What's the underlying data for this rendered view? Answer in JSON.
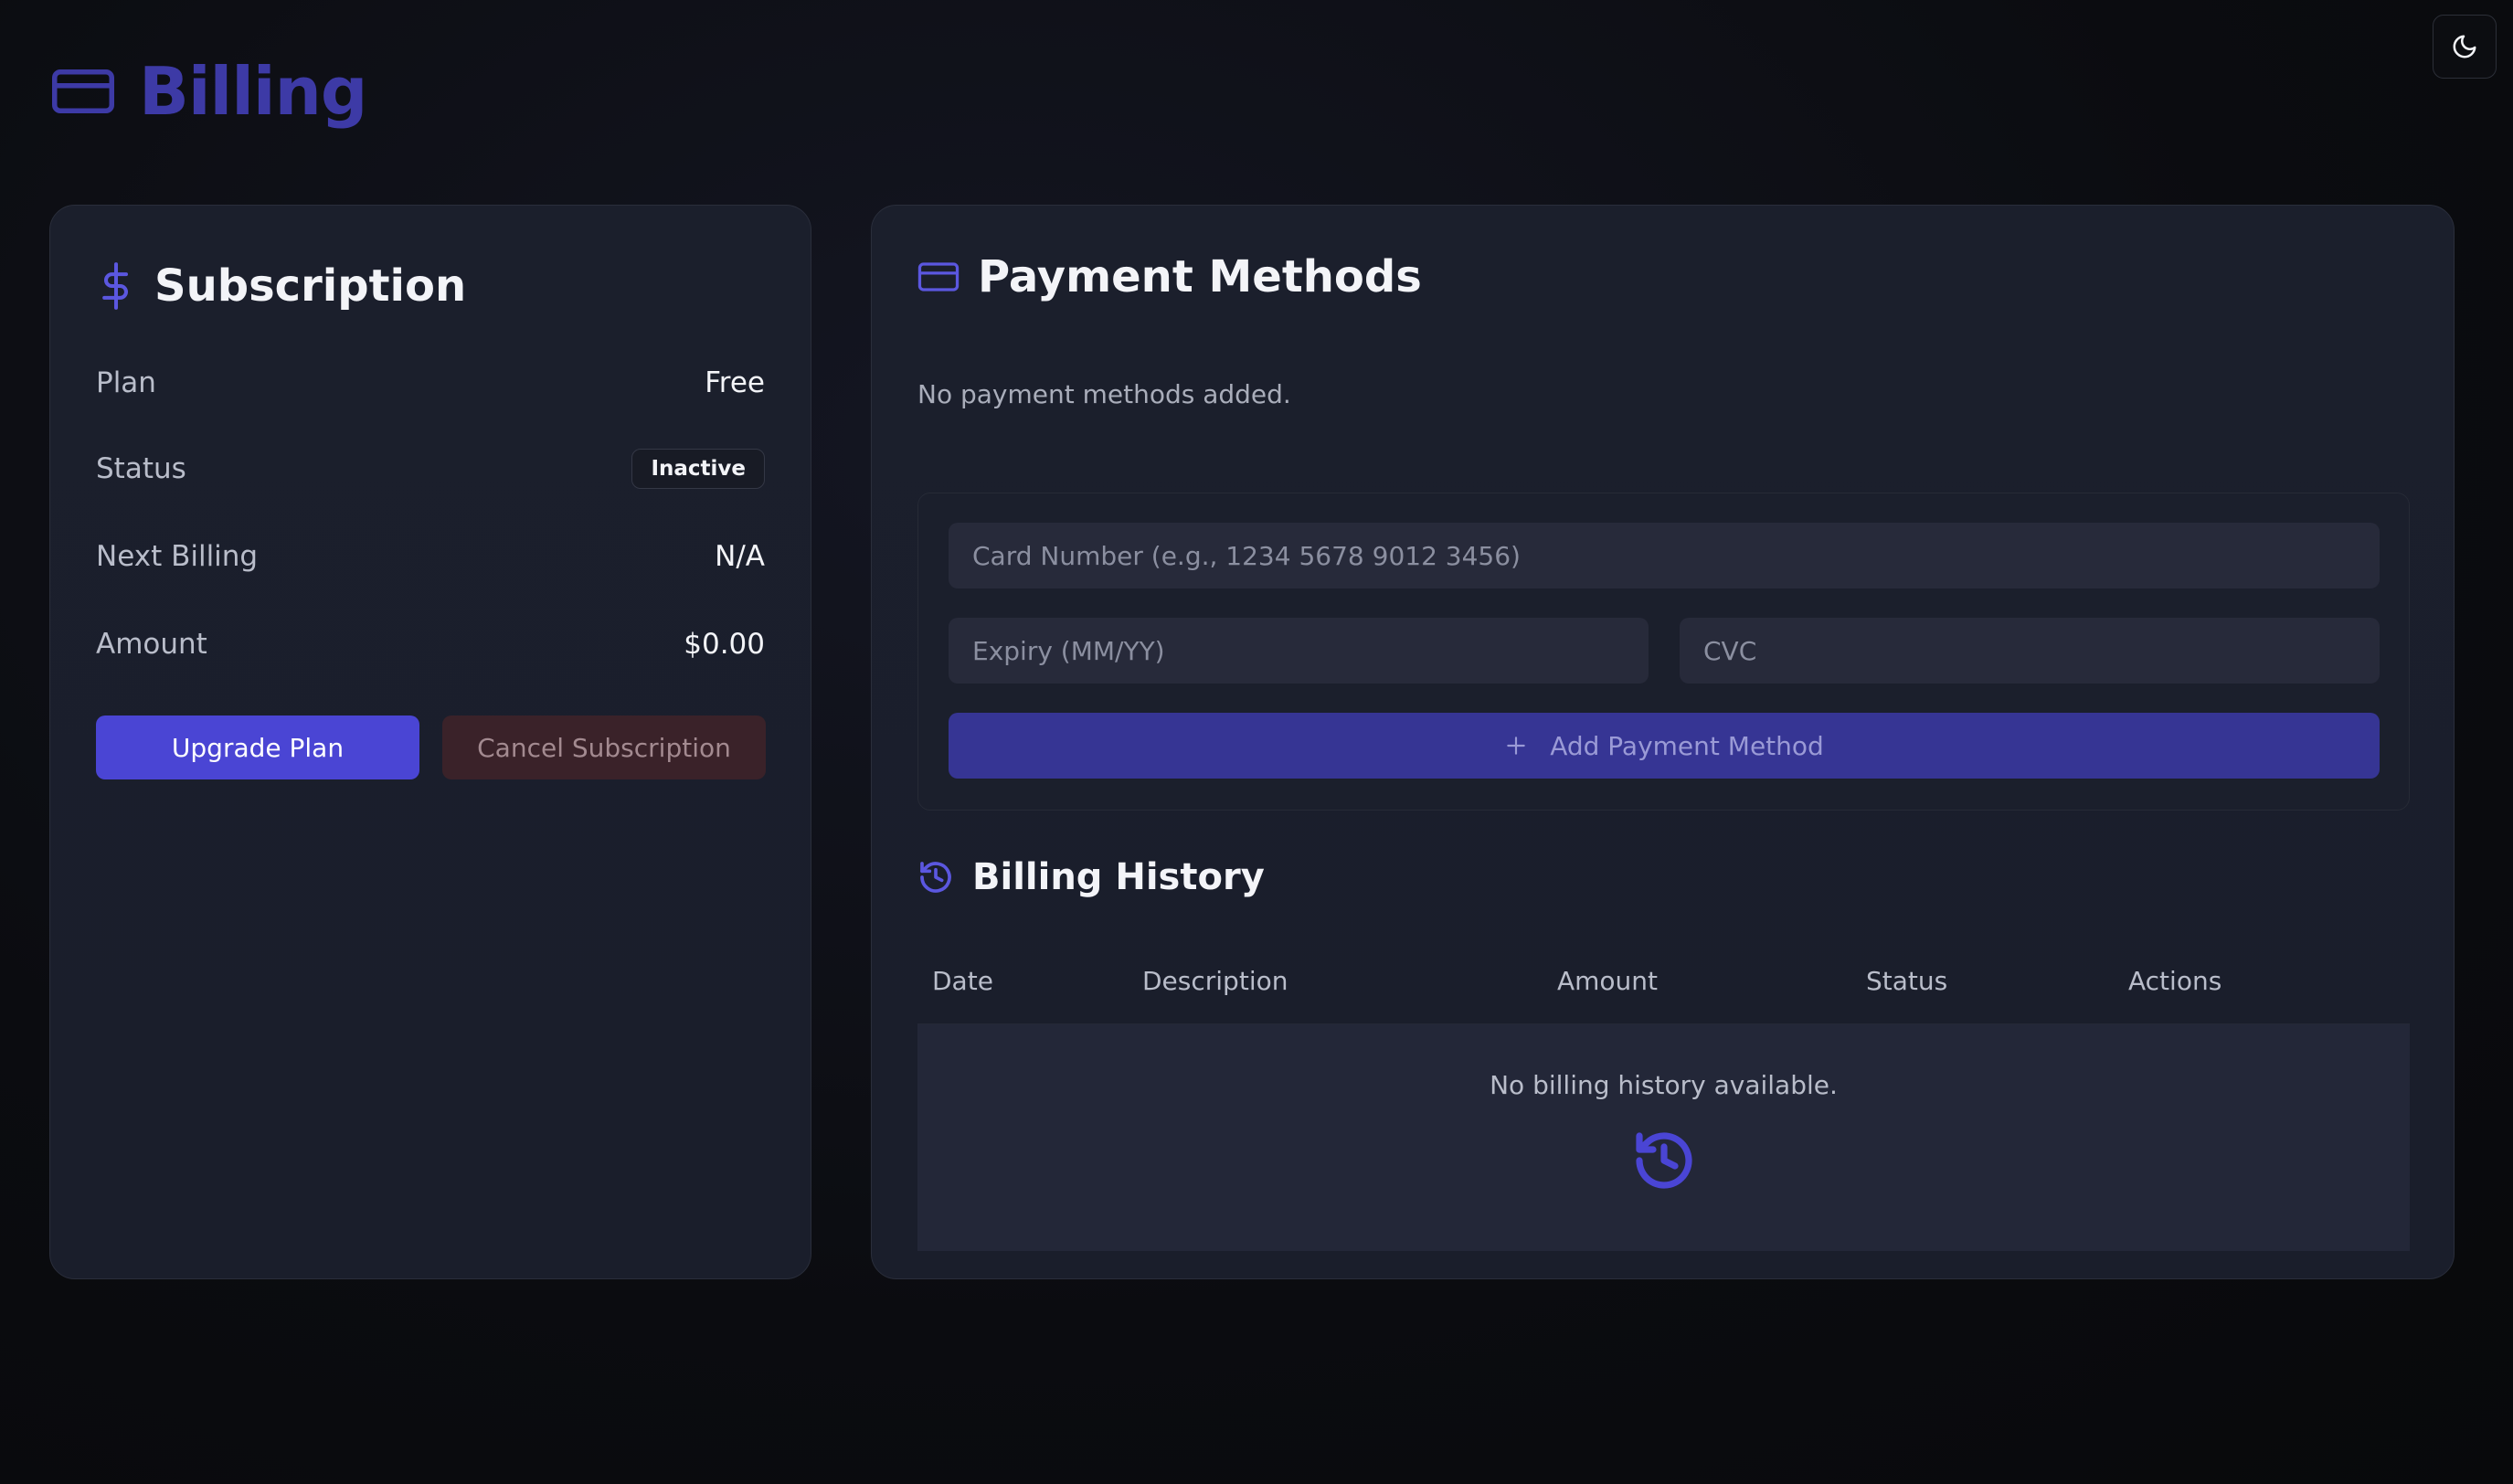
{
  "header": {
    "title": "Billing",
    "icon": "credit-card-icon"
  },
  "theme_toggle": {
    "icon": "moon-icon"
  },
  "subscription": {
    "title": "Subscription",
    "icon": "dollar-icon",
    "rows": [
      {
        "label": "Plan",
        "value": "Free"
      },
      {
        "label": "Status",
        "value": "Inactive"
      },
      {
        "label": "Next Billing",
        "value": "N/A"
      },
      {
        "label": "Amount",
        "value": "$0.00"
      }
    ],
    "upgrade_label": "Upgrade Plan",
    "cancel_label": "Cancel Subscription"
  },
  "payment": {
    "title": "Payment Methods",
    "icon": "credit-card-icon",
    "empty_text": "No payment methods added.",
    "card_number_placeholder": "Card Number (e.g., 1234 5678 9012 3456)",
    "expiry_placeholder": "Expiry (MM/YY)",
    "cvc_placeholder": "CVC",
    "add_label": "Add Payment Method",
    "add_icon": "plus-icon"
  },
  "history": {
    "title": "Billing History",
    "icon": "history-icon",
    "columns": [
      "Date",
      "Description",
      "Amount",
      "Status",
      "Actions"
    ],
    "empty_text": "No billing history available."
  },
  "colors": {
    "accent": "#4a45d4",
    "accent_dark": "#3d3aa6",
    "danger_bg": "#3a2229"
  }
}
